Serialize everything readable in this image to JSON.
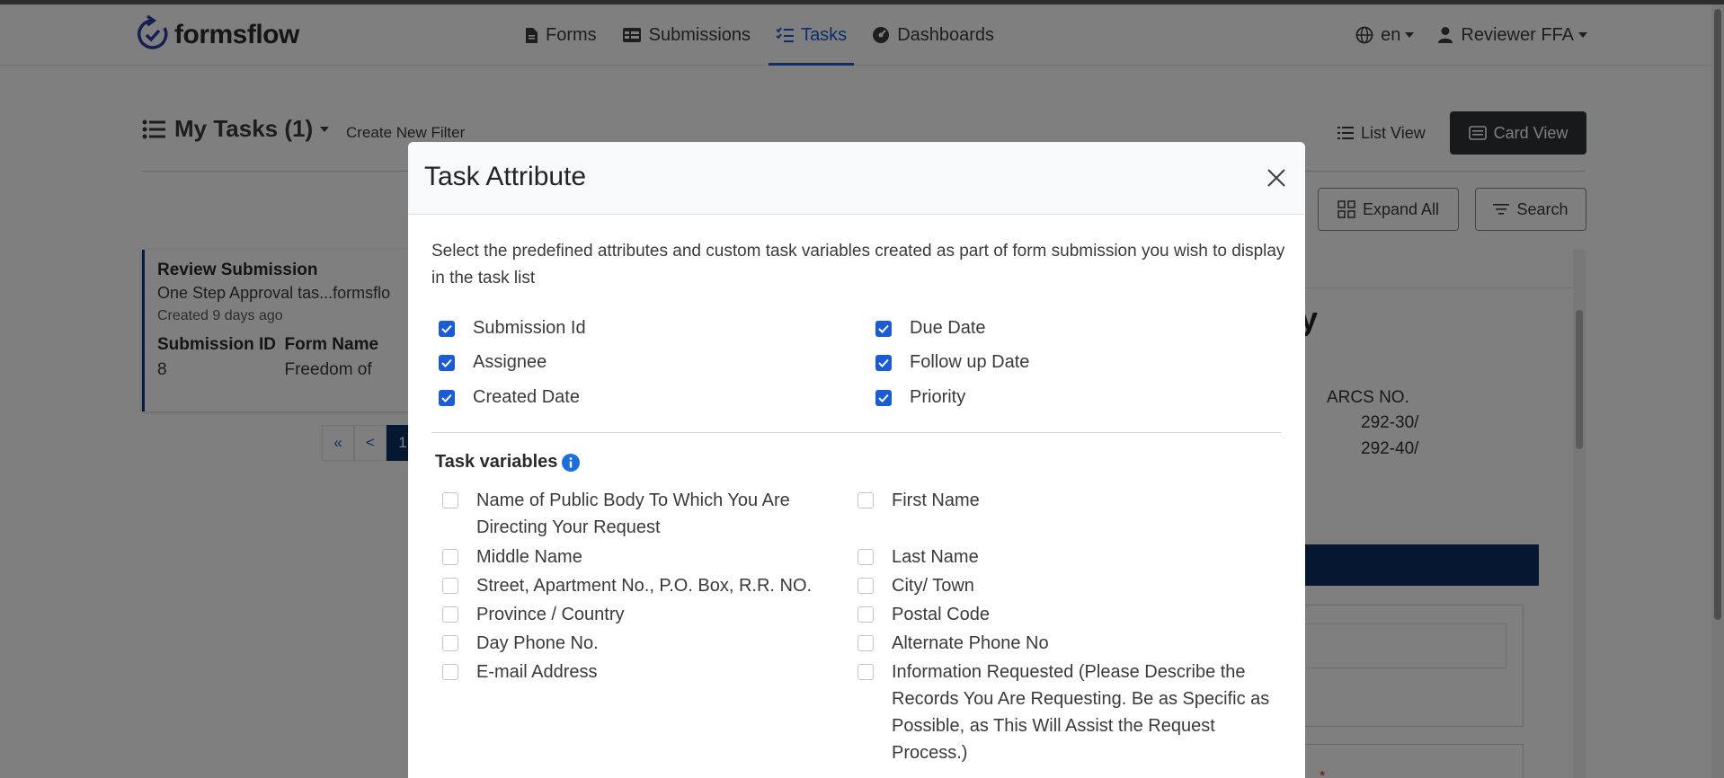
{
  "navbar": {
    "brand": "formsflow",
    "links": [
      {
        "label": "Forms",
        "icon": "file-icon",
        "active": false
      },
      {
        "label": "Submissions",
        "icon": "table-icon",
        "active": false
      },
      {
        "label": "Tasks",
        "icon": "tasks-icon",
        "active": true
      },
      {
        "label": "Dashboards",
        "icon": "dashboard-icon",
        "active": false
      }
    ],
    "language": "en",
    "user": "Reviewer FFA",
    "accent_color": "#1a5bd6"
  },
  "tasks_page": {
    "title": "My Tasks (1)",
    "create_filter": "Create New Filter",
    "list_view": "List View",
    "card_view": "Card View",
    "expand_all": "Expand All",
    "search": "Search",
    "card": {
      "title": "Review Submission",
      "subtitle": "One Step Approval tas...formsflo",
      "created": "Created 9 days ago",
      "col1_label": "Submission ID",
      "col1_value": "8",
      "col2_label": "Form Name",
      "col2_value": "Freedom of"
    },
    "pager": [
      "«",
      "<",
      "1"
    ],
    "detail": {
      "heading_fragment": "y",
      "arcs_label": "ARCS NO.",
      "arcs_values": [
        "292-30/",
        "292-40/"
      ],
      "required_mark": "*"
    }
  },
  "modal": {
    "title": "Task Attribute",
    "intro": "Select the predefined attributes and custom task variables created as part of form submission you wish to display in the task list",
    "attributes_left": [
      "Submission Id",
      "Assignee",
      "Created Date"
    ],
    "attributes_right": [
      "Due Date",
      "Follow up Date",
      "Priority"
    ],
    "task_variables_heading": "Task variables",
    "variables_left": [
      "Name of Public Body To Which You Are Directing Your Request",
      "Middle Name",
      "Street, Apartment No., P.O. Box, R.R. NO.",
      "Province / Country",
      "Day Phone No.",
      "E-mail Address"
    ],
    "variables_right": [
      "First Name",
      "Last Name",
      "City/ Town",
      "Postal Code",
      "Alternate Phone No",
      "Information Requested (Please Describe the Records You Are Requesting. Be as Specific as Possible, as This Will Assist the Request Process.)"
    ]
  }
}
